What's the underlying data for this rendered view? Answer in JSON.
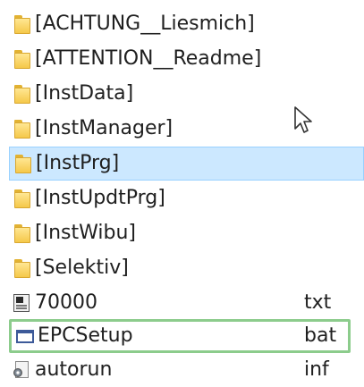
{
  "files": [
    {
      "name": "[ACHTUNG__Liesmich]",
      "ext": "",
      "icon": "folder-icon",
      "selected": false,
      "highlight": false
    },
    {
      "name": "[ATTENTION__Readme]",
      "ext": "",
      "icon": "folder-icon",
      "selected": false,
      "highlight": false
    },
    {
      "name": "[InstData]",
      "ext": "",
      "icon": "folder-icon",
      "selected": false,
      "highlight": false
    },
    {
      "name": "[InstManager]",
      "ext": "",
      "icon": "folder-icon",
      "selected": false,
      "highlight": false
    },
    {
      "name": "[InstPrg]",
      "ext": "",
      "icon": "folder-icon",
      "selected": true,
      "highlight": false
    },
    {
      "name": "[InstUpdtPrg]",
      "ext": "",
      "icon": "folder-icon",
      "selected": false,
      "highlight": false
    },
    {
      "name": "[InstWibu]",
      "ext": "",
      "icon": "folder-icon",
      "selected": false,
      "highlight": false
    },
    {
      "name": "[Selektiv]",
      "ext": "",
      "icon": "folder-icon",
      "selected": false,
      "highlight": false
    },
    {
      "name": "70000",
      "ext": "txt",
      "icon": "text-file-icon",
      "selected": false,
      "highlight": false
    },
    {
      "name": "EPCSetup",
      "ext": "bat",
      "icon": "batch-file-icon",
      "selected": false,
      "highlight": true
    },
    {
      "name": "autorun",
      "ext": "inf",
      "icon": "setup-info-icon",
      "selected": false,
      "highlight": false
    }
  ],
  "colors": {
    "selection_bg": "#cce8ff",
    "selection_border": "#99d1ff",
    "highlight_border": "#8ccc8c",
    "folder": "#f5c84a"
  }
}
